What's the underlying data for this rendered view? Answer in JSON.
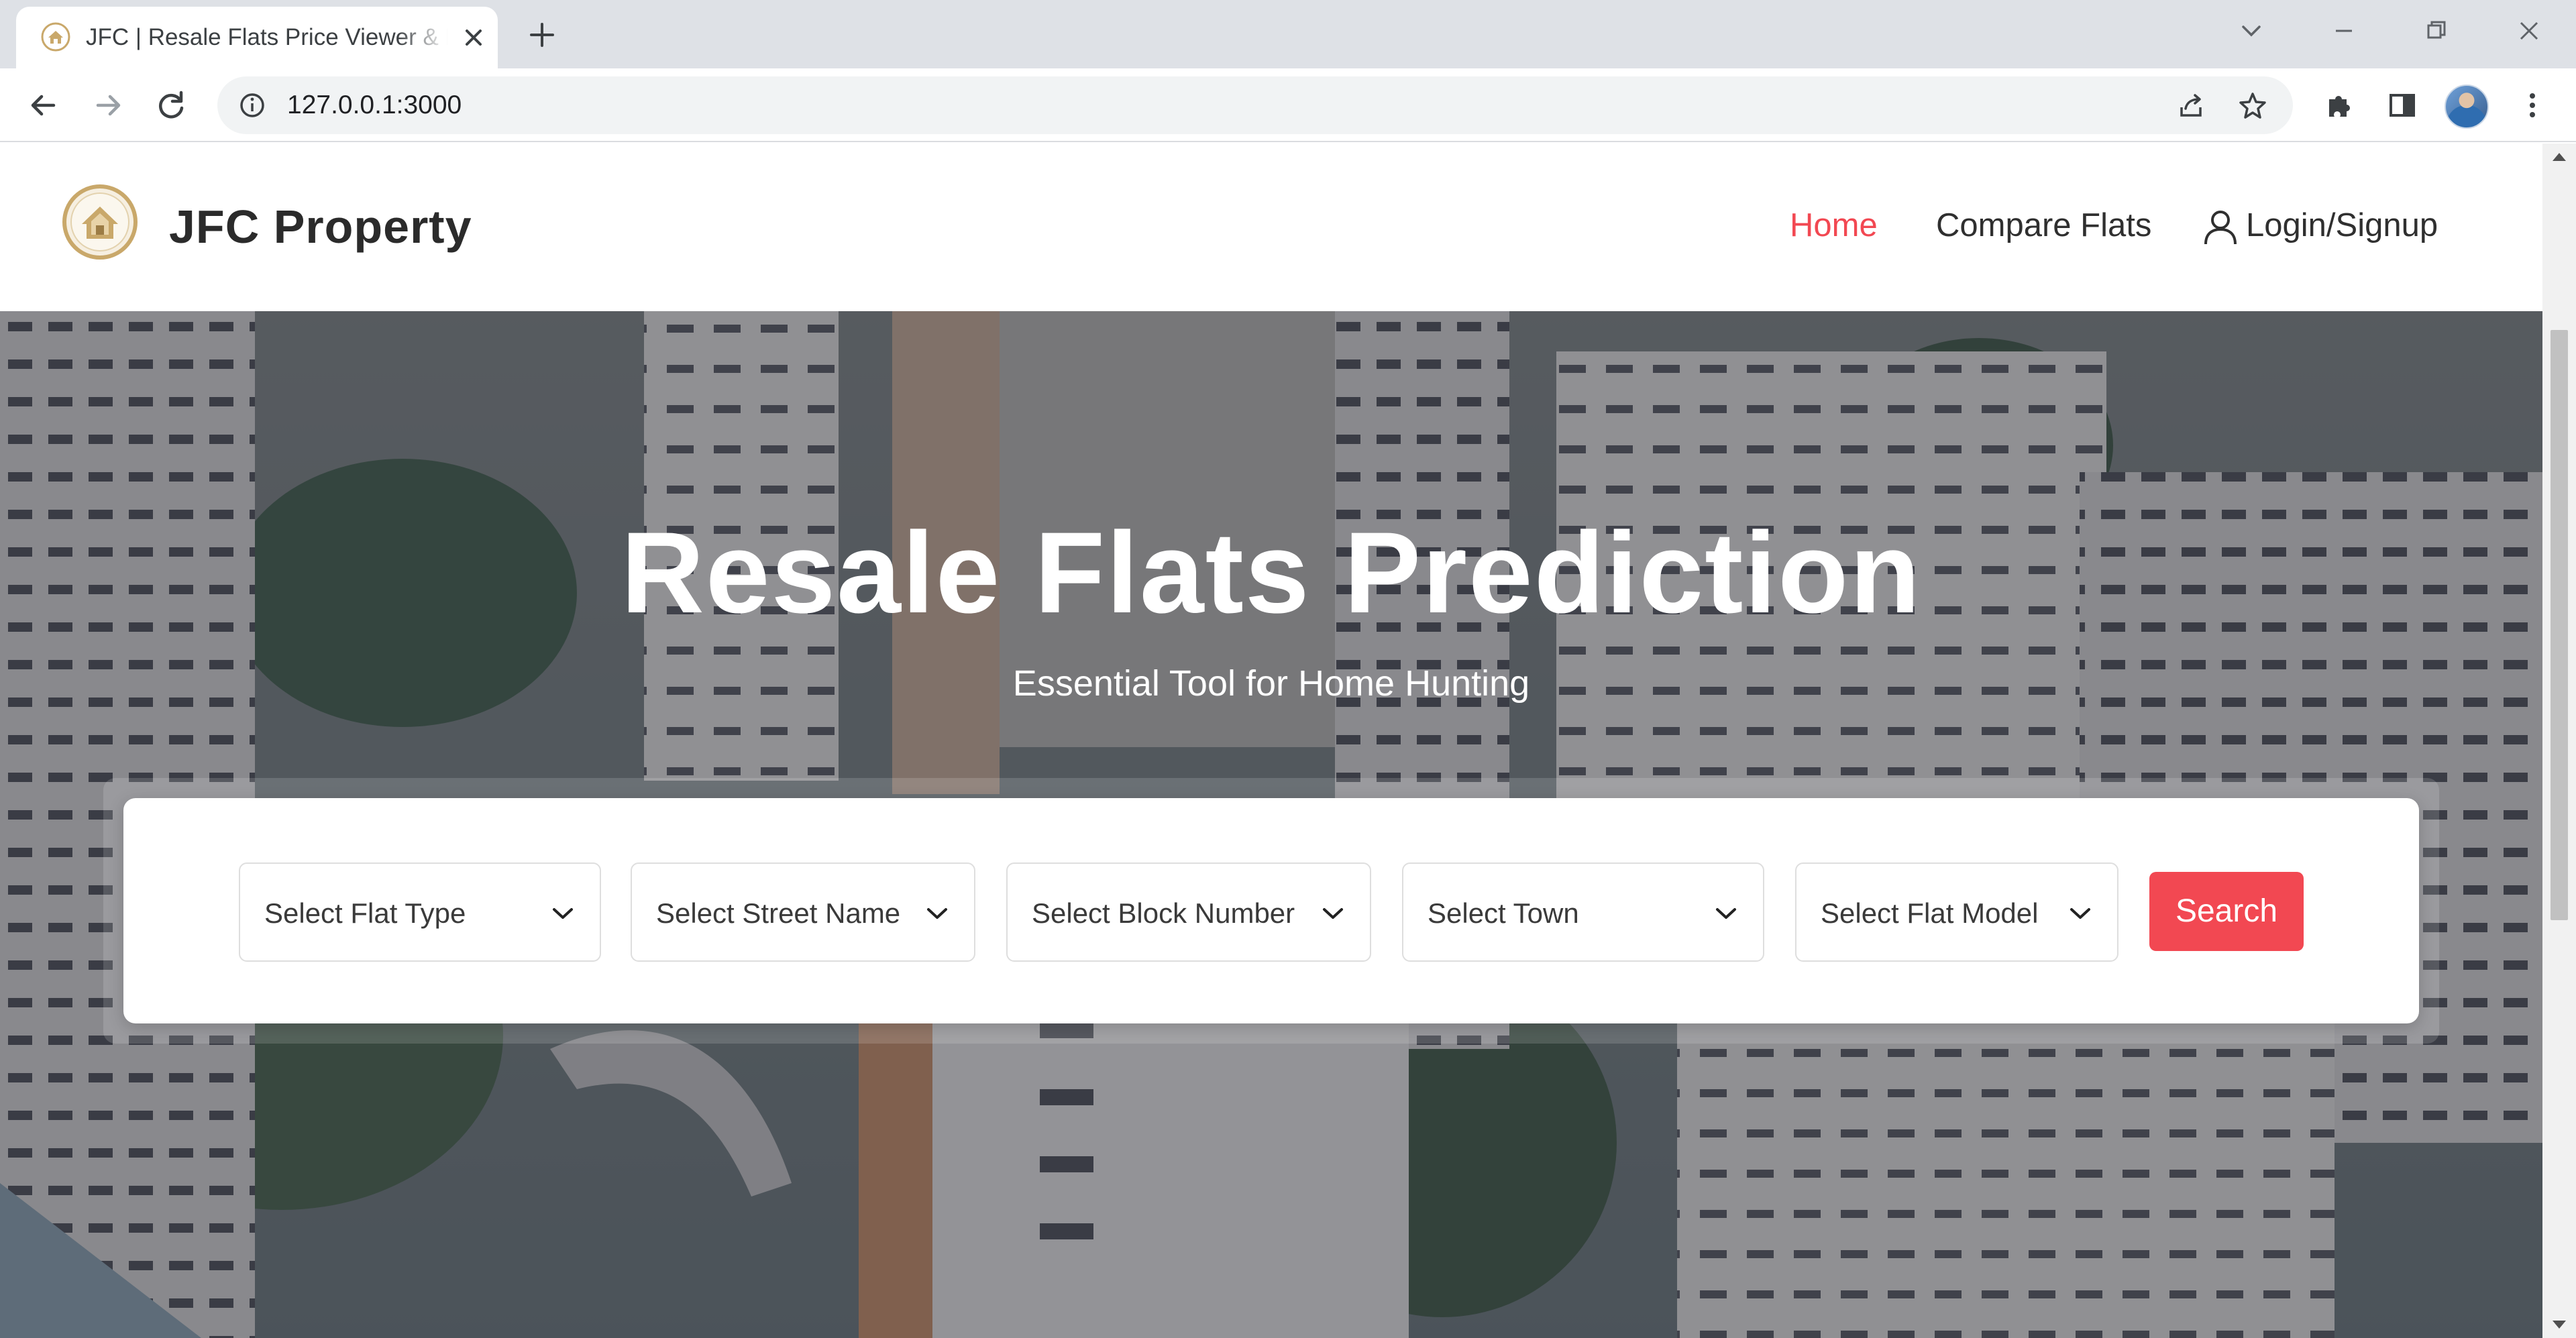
{
  "browser": {
    "tab_title": "JFC | Resale Flats Price Viewer & Predictor",
    "url": "127.0.0.1:3000"
  },
  "site": {
    "brand": "JFC Property",
    "nav": {
      "home": "Home",
      "compare": "Compare Flats",
      "login": "Login/Signup"
    }
  },
  "hero": {
    "title": "Resale Flats Prediction",
    "subtitle": "Essential Tool for Home Hunting"
  },
  "search": {
    "flat_type": "Select Flat Type",
    "street_name": "Select Street Name",
    "block_number": "Select Block Number",
    "town": "Select Town",
    "flat_model": "Select Flat Model",
    "button": "Search"
  },
  "colors": {
    "accent": "#f24852",
    "logo_gold": "#c9a86a",
    "tab_strip": "#dee1e6"
  },
  "icons": [
    "house-logo-icon",
    "close-icon",
    "plus-icon",
    "back-arrow-icon",
    "forward-arrow-icon",
    "reload-icon",
    "info-icon",
    "share-icon",
    "star-icon",
    "extensions-icon",
    "side-panel-icon",
    "more-icon",
    "user-icon",
    "chevron-down-icon"
  ]
}
